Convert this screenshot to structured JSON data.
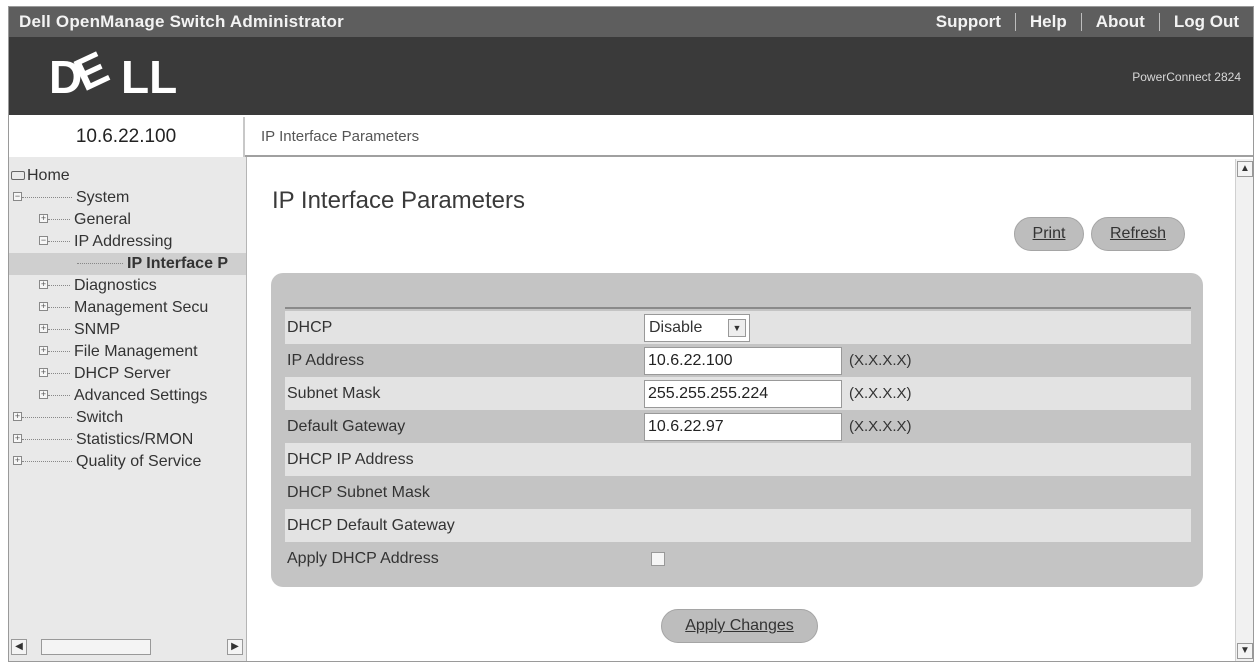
{
  "topbar": {
    "title": "Dell OpenManage Switch Administrator",
    "links": [
      "Support",
      "Help",
      "About",
      "Log Out"
    ]
  },
  "banner": {
    "logo": "DELL",
    "model": "PowerConnect 2824"
  },
  "address": "10.6.22.100",
  "breadcrumb": "IP Interface Parameters",
  "tree": {
    "home": "Home",
    "system": "System",
    "general": "General",
    "ip_addressing": "IP Addressing",
    "ip_interface": "IP Interface P",
    "diagnostics": "Diagnostics",
    "management_security": "Management Secu",
    "snmp": "SNMP",
    "file_management": "File Management",
    "dhcp_server": "DHCP Server",
    "advanced_settings": "Advanced Settings",
    "switch": "Switch",
    "statistics": "Statistics/RMON",
    "qos": "Quality of Service"
  },
  "main": {
    "title": "IP Interface Parameters",
    "print_label": "Print",
    "refresh_label": "Refresh",
    "apply_label": "Apply Changes"
  },
  "form": {
    "dhcp_label": "DHCP",
    "dhcp_value": "Disable",
    "ip_label": "IP Address",
    "ip_value": "10.6.22.100",
    "ip_hint": "(X.X.X.X)",
    "mask_label": "Subnet Mask",
    "mask_value": "255.255.255.224",
    "mask_hint": "(X.X.X.X)",
    "gw_label": "Default Gateway",
    "gw_value": "10.6.22.97",
    "gw_hint": "(X.X.X.X)",
    "dhcp_ip_label": "DHCP IP Address",
    "dhcp_mask_label": "DHCP Subnet Mask",
    "dhcp_gw_label": "DHCP Default Gateway",
    "apply_dhcp_label": "Apply DHCP Address",
    "apply_dhcp_checked": false
  },
  "colors": {
    "topbar": "#5e5e5e",
    "banner": "#3a3a3a",
    "panel": "#c4c4c4",
    "row_light": "#e3e3e3",
    "button": "#bdbdbd"
  }
}
